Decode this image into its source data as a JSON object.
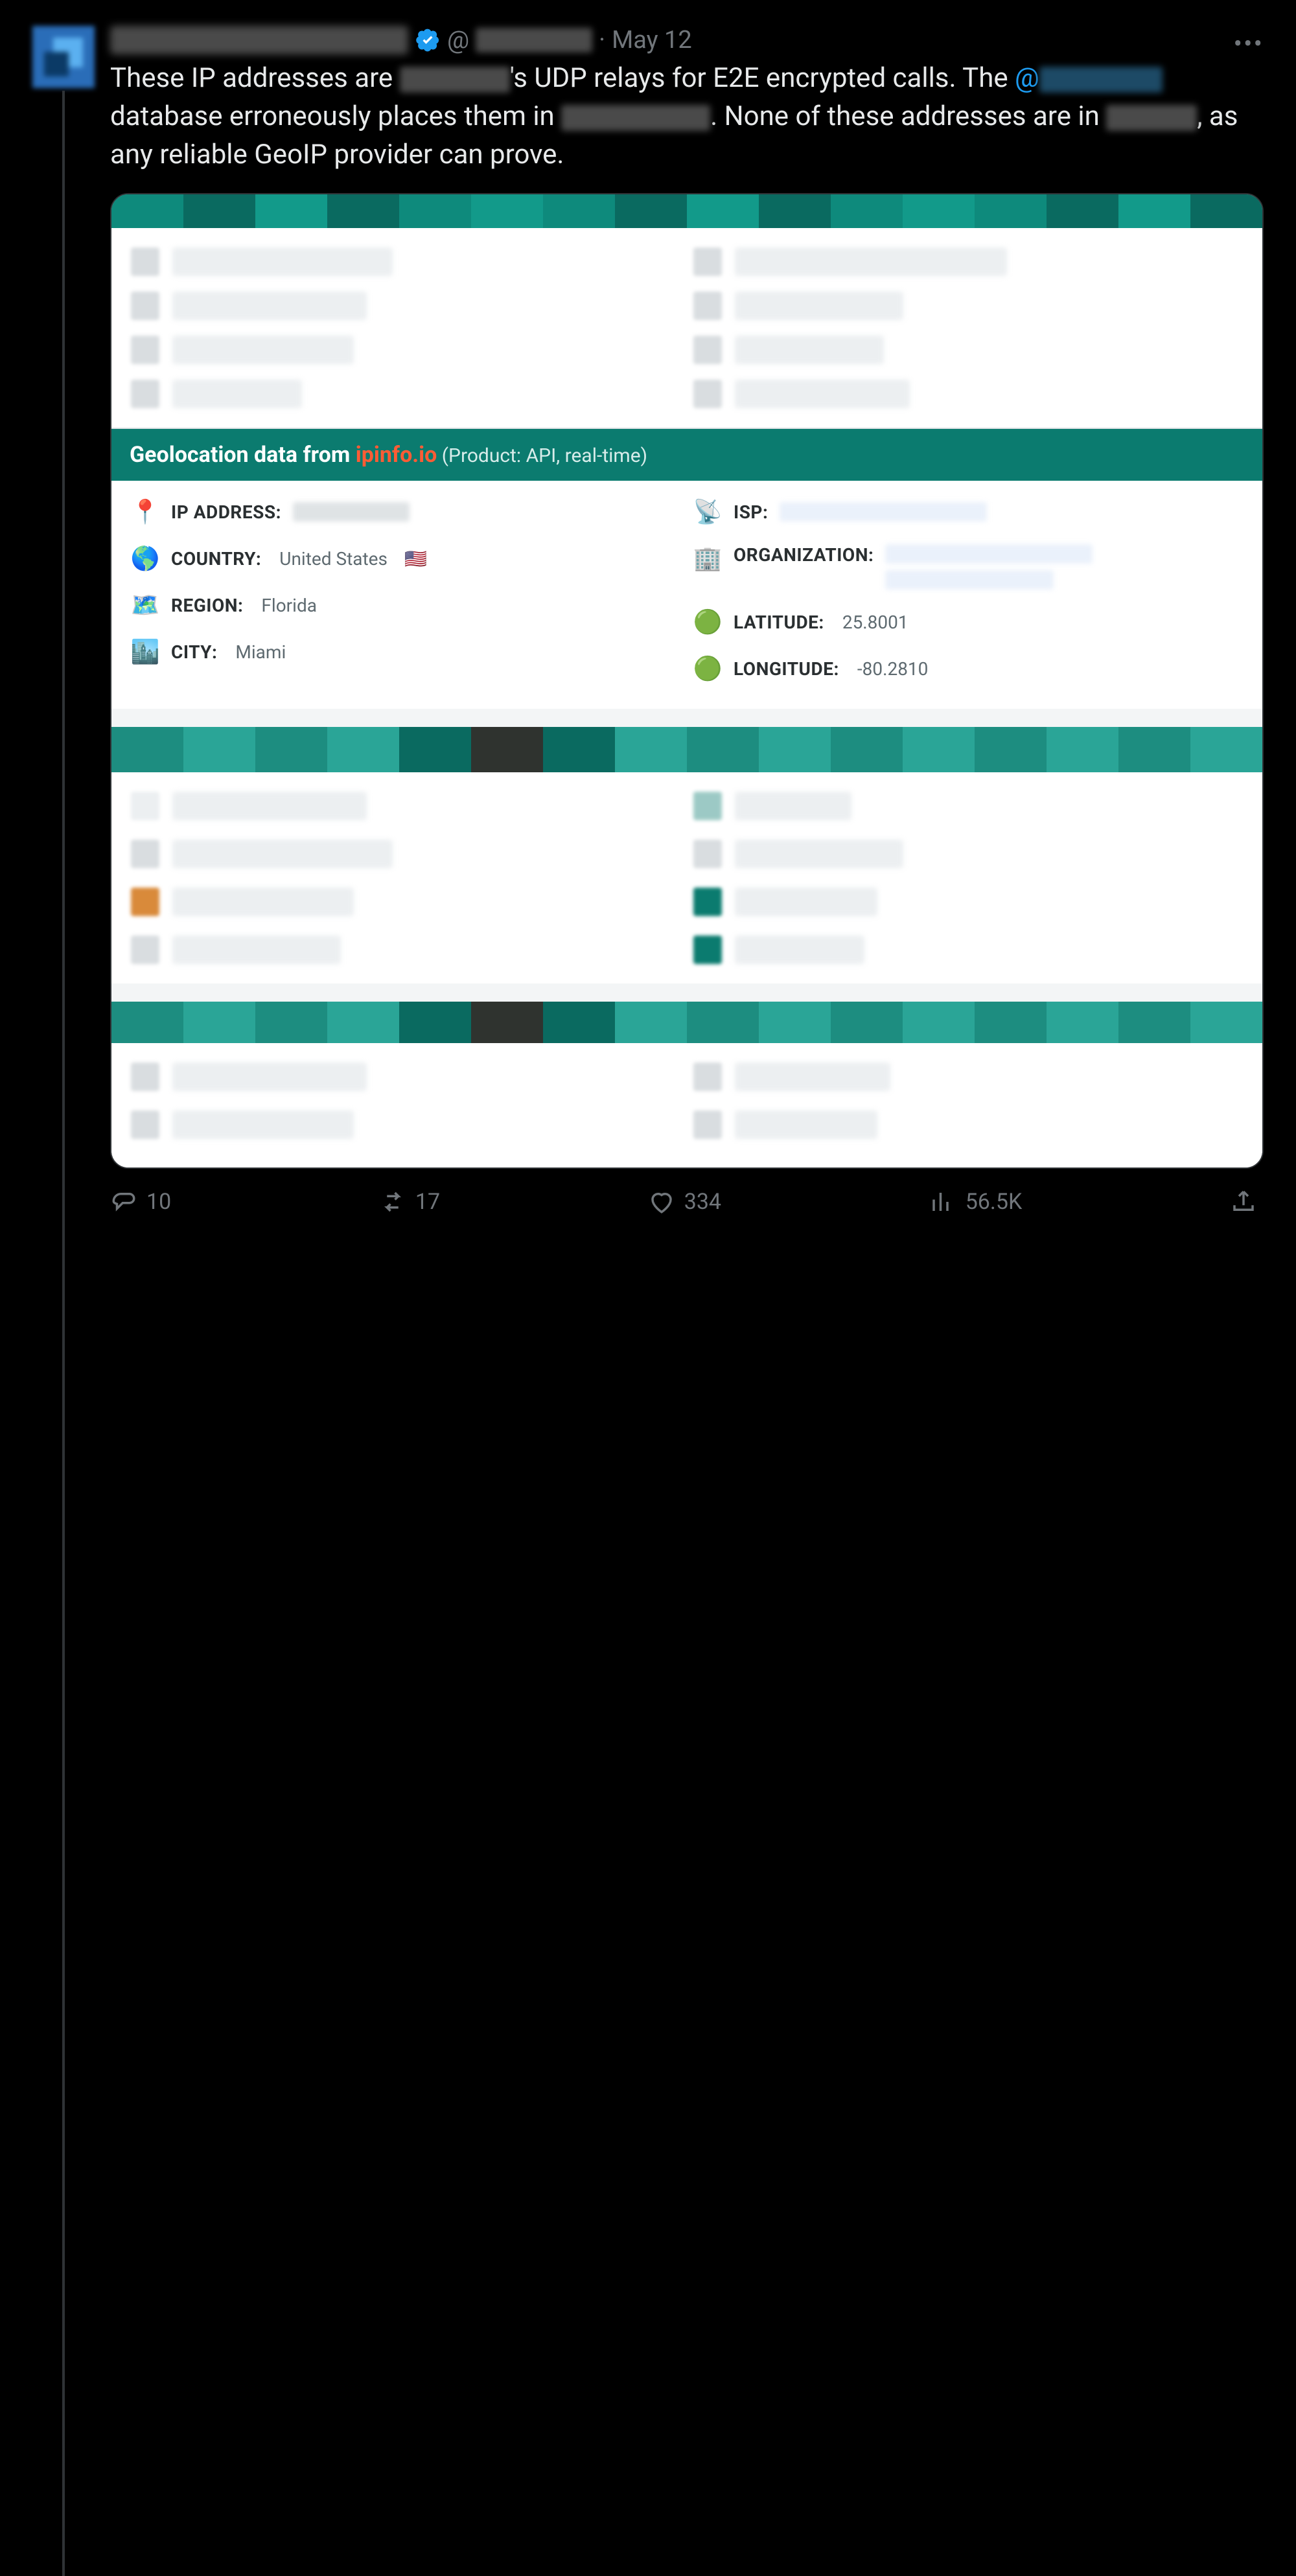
{
  "tweet": {
    "handle_prefix": "@",
    "dot": "·",
    "date": "May 12",
    "text_parts": {
      "p1": "These IP addresses are ",
      "p2": "'s UDP relays for E2E encrypted calls. The ",
      "mention_at": "@",
      "p3": " database erroneously places them in ",
      "p4": ". None of these addresses are in ",
      "p5": ", as any reliable GeoIP provider can prove."
    }
  },
  "geo_panel": {
    "heading_prefix": "Geolocation data from ",
    "heading_brand": "ipinfo.io",
    "heading_paren": " (Product: API, real-time)",
    "left": {
      "ip_label": "IP ADDRESS:",
      "country_label": "COUNTRY:",
      "country_value": "United States",
      "region_label": "REGION:",
      "region_value": "Florida",
      "city_label": "CITY:",
      "city_value": "Miami"
    },
    "right": {
      "isp_label": "ISP:",
      "org_label": "ORGANIZATION:",
      "lat_label": "LATITUDE:",
      "lat_value": "25.8001",
      "lon_label": "LONGITUDE:",
      "lon_value": "-80.2810"
    }
  },
  "actions": {
    "replies": "10",
    "retweets": "17",
    "likes": "334",
    "views": "56.5K"
  }
}
